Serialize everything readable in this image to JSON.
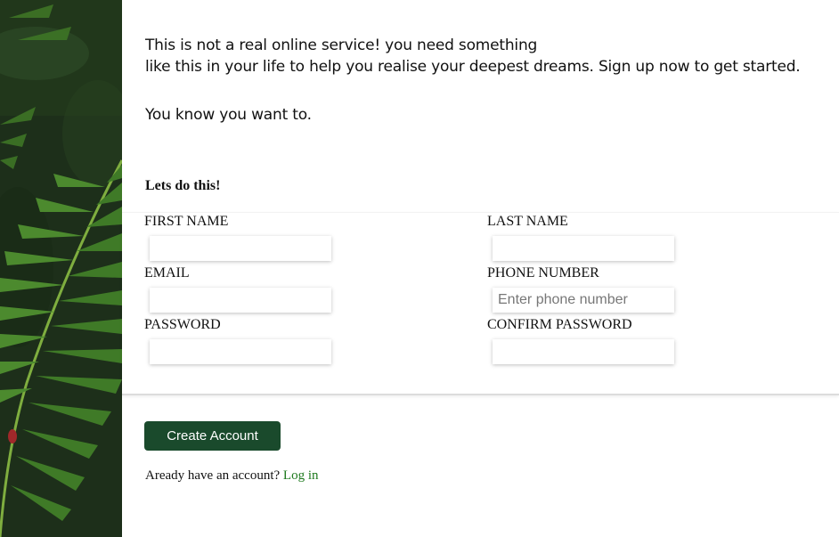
{
  "intro": {
    "line1": "This is not a real online service! you need something",
    "line2": "like this in your life to help you realise your deepest dreams. Sign up now to get started.",
    "line3": "You know you want to."
  },
  "form": {
    "heading": "Lets do this!",
    "fields": {
      "first_name": {
        "label": "FIRST NAME",
        "value": "",
        "placeholder": ""
      },
      "last_name": {
        "label": "LAST NAME",
        "value": "",
        "placeholder": ""
      },
      "email": {
        "label": "EMAIL",
        "value": "",
        "placeholder": ""
      },
      "phone": {
        "label": "PHONE NUMBER",
        "value": "",
        "placeholder": "Enter phone number"
      },
      "password": {
        "label": "PASSWORD",
        "value": "",
        "placeholder": ""
      },
      "confirm_password": {
        "label": "CONFIRM PASSWORD",
        "value": "",
        "placeholder": ""
      }
    },
    "submit_label": "Create Account"
  },
  "login": {
    "prompt": "Aready have an account?",
    "link_label": "Log in"
  },
  "side_image": {
    "icon": "fern-leaf-image"
  },
  "colors": {
    "button": "#1a4a2c",
    "link": "#1e7a1e"
  }
}
